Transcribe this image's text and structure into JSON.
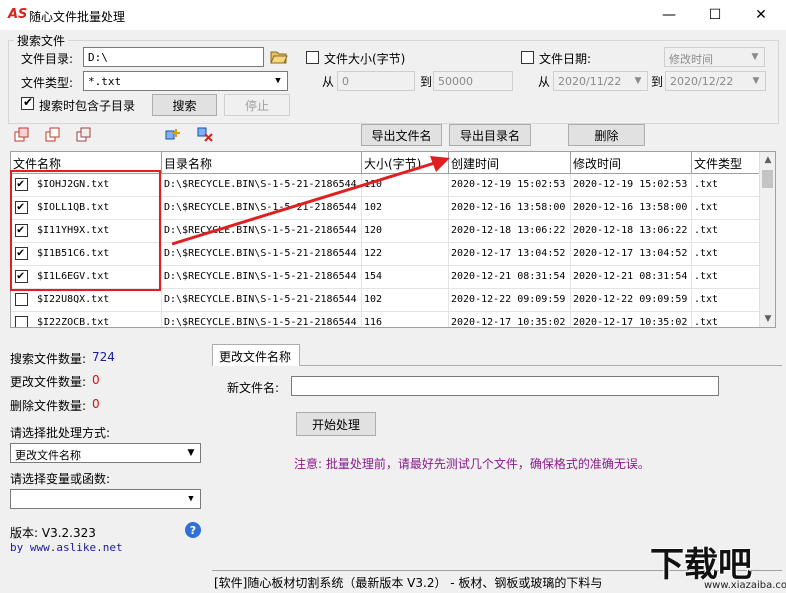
{
  "window": {
    "title": "随心文件批量处理",
    "logo": "AS",
    "minimize": "—",
    "maximize": "☐",
    "close": "✕"
  },
  "search": {
    "group_label": "搜索文件",
    "dir_label": "文件目录:",
    "dir_value": "D:\\",
    "type_label": "文件类型:",
    "type_value": "*.txt",
    "subdir_label": "搜索时包含子目录",
    "subdir_checked": true,
    "search_button": "搜索",
    "stop_button": "停止",
    "size_label": "文件大小(字节)",
    "size_checked": false,
    "from_label": "从",
    "to_label": "到",
    "size_from": "0",
    "size_to": "50000",
    "date_label": "文件日期:",
    "date_checked": false,
    "date_type": "修改时间",
    "date_from_label": "从",
    "date_to_label": "到",
    "date_from": "2020/11/22",
    "date_to": "2020/12/22"
  },
  "toolbar": {
    "export_files": "导出文件名",
    "export_dirs": "导出目录名",
    "delete": "删除"
  },
  "grid": {
    "columns": [
      "文件名称",
      "目录名称",
      "大小(字节)",
      "创建时间",
      "修改时间",
      "文件类型"
    ],
    "rows": [
      {
        "checked": true,
        "name": "$IOHJ2GN.txt",
        "dir": "D:\\$RECYCLE.BIN\\S-1-5-21-2186544",
        "size": "110",
        "created": "2020-12-19 15:02:53",
        "modified": "2020-12-19 15:02:53",
        "type": ".txt"
      },
      {
        "checked": true,
        "name": "$IOLL1QB.txt",
        "dir": "D:\\$RECYCLE.BIN\\S-1-5-21-2186544",
        "size": "102",
        "created": "2020-12-16 13:58:00",
        "modified": "2020-12-16 13:58:00",
        "type": ".txt"
      },
      {
        "checked": true,
        "name": "$I11YH9X.txt",
        "dir": "D:\\$RECYCLE.BIN\\S-1-5-21-2186544",
        "size": "120",
        "created": "2020-12-18 13:06:22",
        "modified": "2020-12-18 13:06:22",
        "type": ".txt"
      },
      {
        "checked": true,
        "name": "$I1B51C6.txt",
        "dir": "D:\\$RECYCLE.BIN\\S-1-5-21-2186544",
        "size": "122",
        "created": "2020-12-17 13:04:52",
        "modified": "2020-12-17 13:04:52",
        "type": ".txt"
      },
      {
        "checked": true,
        "name": "$I1L6EGV.txt",
        "dir": "D:\\$RECYCLE.BIN\\S-1-5-21-2186544",
        "size": "154",
        "created": "2020-12-21 08:31:54",
        "modified": "2020-12-21 08:31:54",
        "type": ".txt"
      },
      {
        "checked": false,
        "name": "$I22U8QX.txt",
        "dir": "D:\\$RECYCLE.BIN\\S-1-5-21-2186544",
        "size": "102",
        "created": "2020-12-22 09:09:59",
        "modified": "2020-12-22 09:09:59",
        "type": ".txt"
      },
      {
        "checked": false,
        "name": "$I22ZOCB.txt",
        "dir": "D:\\$RECYCLE.BIN\\S-1-5-21-2186544",
        "size": "116",
        "created": "2020-12-17 10:35:02",
        "modified": "2020-12-17 10:35:02",
        "type": ".txt"
      }
    ]
  },
  "stats": {
    "found_label": "搜索文件数量:",
    "found_value": "724",
    "changed_label": "更改文件数量:",
    "changed_value": "0",
    "deleted_label": "删除文件数量:",
    "deleted_value": "0"
  },
  "mode": {
    "method_label": "请选择批处理方式:",
    "method_value": "更改文件名称",
    "var_label": "请选择变量或函数:",
    "var_value": ""
  },
  "about": {
    "version": "版本: V3.2.323",
    "site": "by www.aslike.net",
    "help_icon": "?"
  },
  "rename": {
    "tab_label": "更改文件名称",
    "new_name_label": "新文件名:",
    "new_name_value": "",
    "start_button": "开始处理",
    "notice": "注意: 批量处理前，请最好先测试几个文件，确保格式的准确无误。"
  },
  "statusbar": {
    "text": "[软件]随心板材切割系统（最新版本 V3.2） - 板材、钢板或玻璃的下料与"
  },
  "watermark": {
    "text": "下载吧",
    "site": "www.xiazaiba.com"
  },
  "colors": {
    "highlight_red": "#e02020",
    "count_blue": "#1a1aa6",
    "count_red": "#d01010",
    "notice_purple": "#8a1a8a",
    "link_blue": "#1a1a9e"
  }
}
